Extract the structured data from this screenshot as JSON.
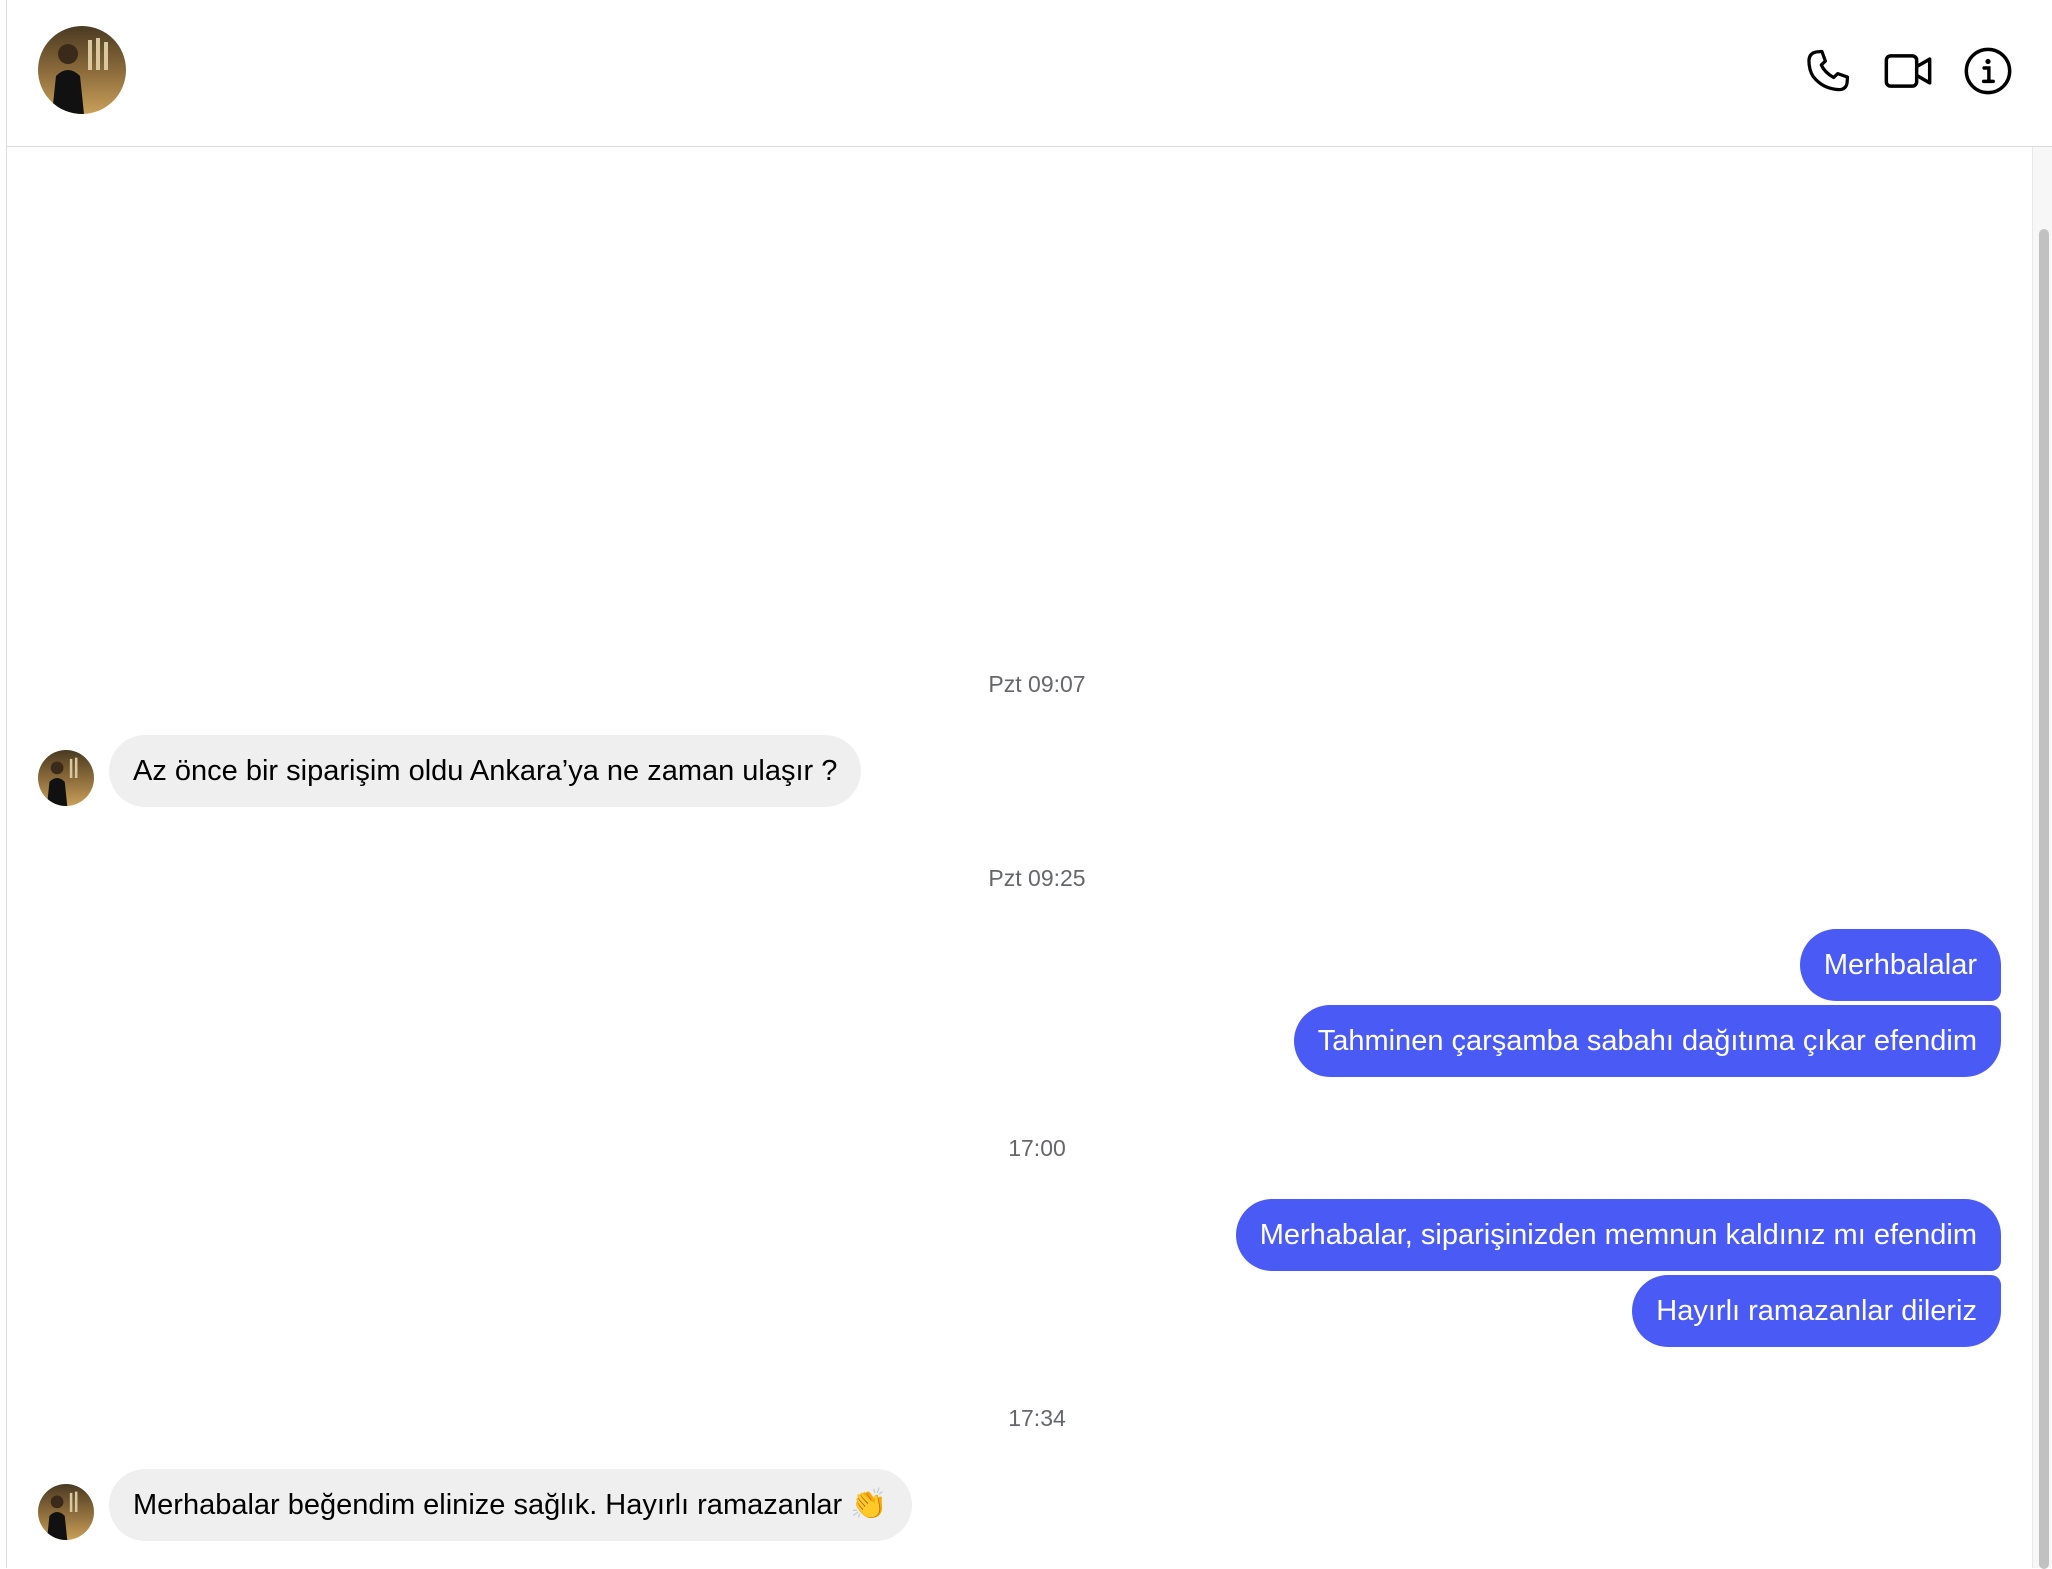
{
  "header": {
    "avatar_alt": "contact avatar",
    "actions": [
      "phone-call",
      "video-call",
      "conversation-info"
    ]
  },
  "messages": {
    "ts1": "Pzt 09:07",
    "m1": "Az önce bir siparişim oldu Ankara’ya ne zaman ulaşır ?",
    "ts2": "Pzt 09:25",
    "m2": "Merhbalalar",
    "m3": "Tahminen çarşamba sabahı dağıtıma çıkar efendim",
    "ts3": "17:00",
    "m4": "Merhabalar, siparişinizden memnun kaldınız mı efendim",
    "m5": "Hayırlı ramazanlar dileriz",
    "ts4": "17:34",
    "m6": "Merhabalar beğendim elinize sağlık. Hayırlı ramazanlar",
    "m6_emoji": "👏"
  },
  "colors": {
    "outgoing_bubble": "#4a5af5",
    "incoming_bubble": "#efefef",
    "timestamp_text": "#65676b"
  }
}
